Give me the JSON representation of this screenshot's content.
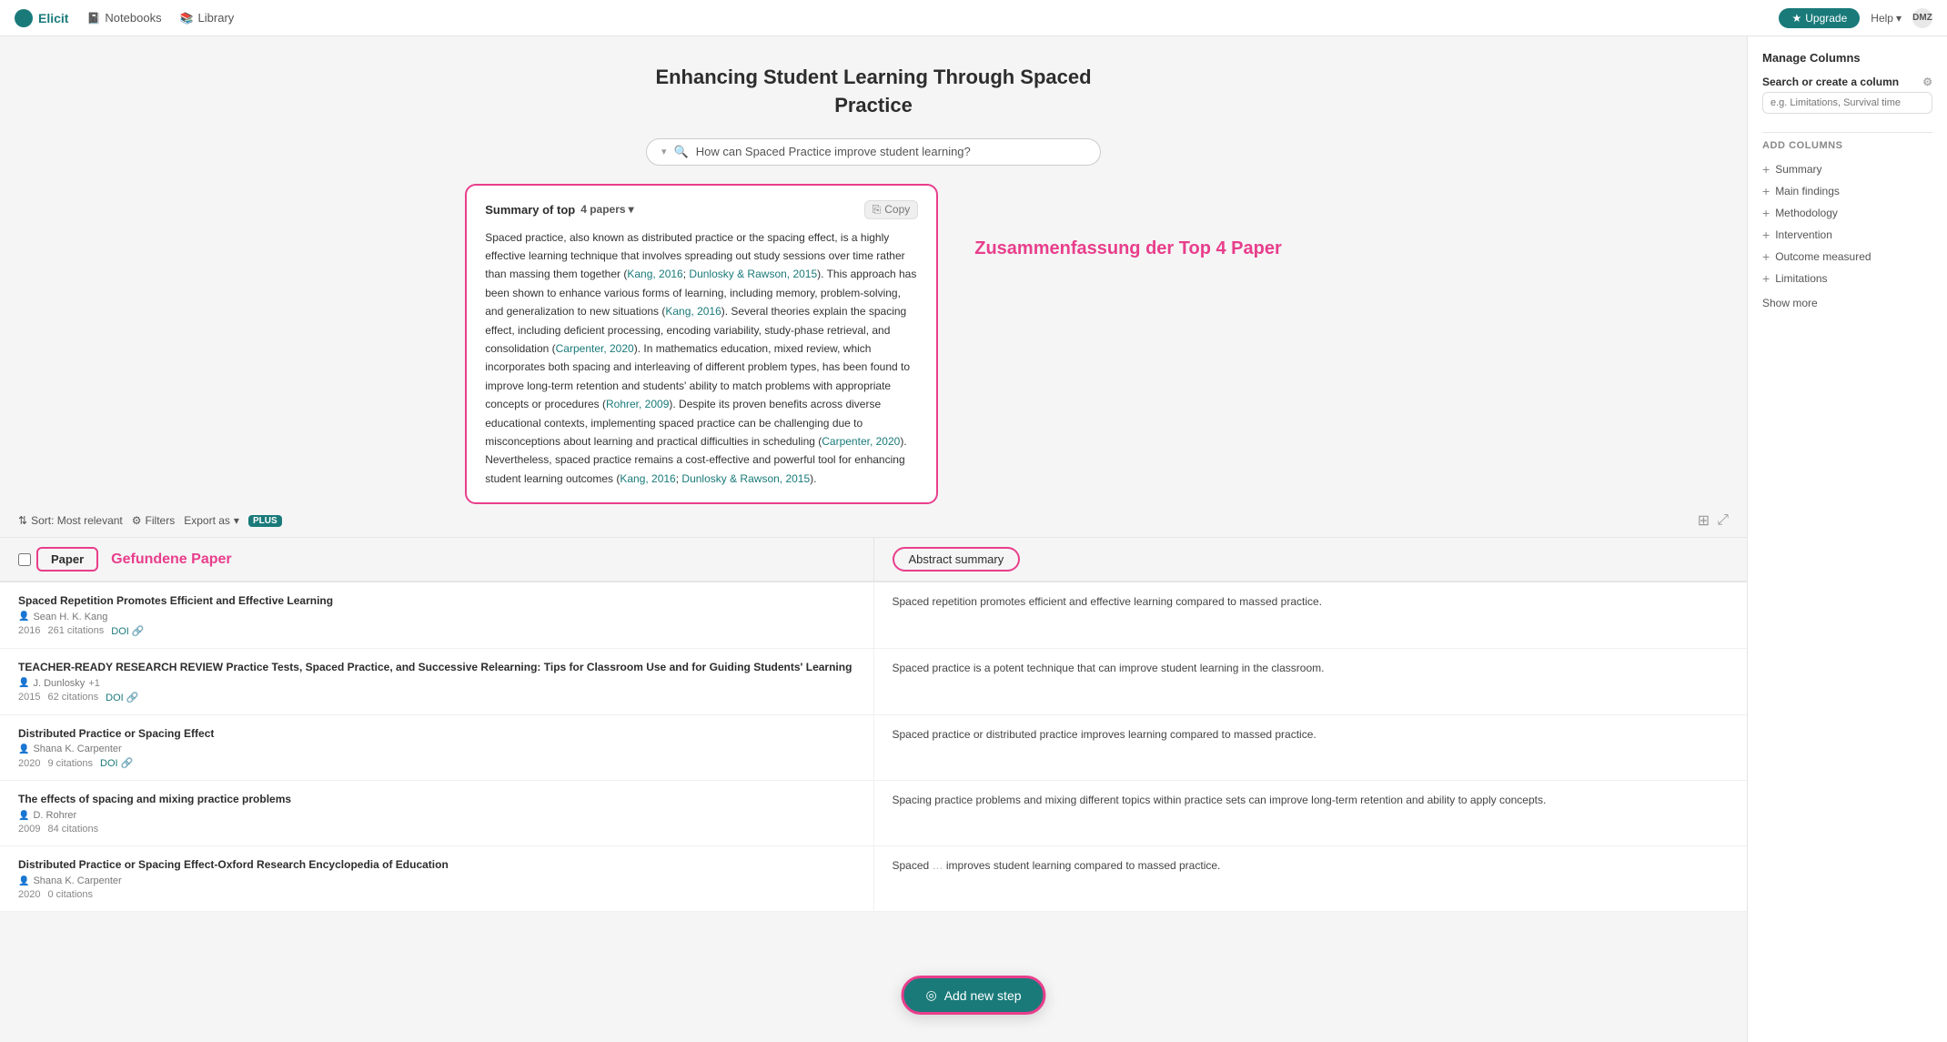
{
  "nav": {
    "logo_text": "Elicit",
    "notebooks_label": "Notebooks",
    "library_label": "Library",
    "upgrade_label": "Upgrade",
    "help_label": "Help",
    "user_label": "DMZ"
  },
  "page": {
    "title_line1": "Enhancing Student Learning Through Spaced",
    "title_line2": "Practice"
  },
  "search": {
    "query": "How can Spaced Practice improve student learning?"
  },
  "summary": {
    "label": "Summary of top",
    "papers_count": "4 papers",
    "copy_label": "Copy",
    "body": "Spaced practice, also known as distributed practice or the spacing effect, is a highly effective learning technique that involves spreading out study sessions over time rather than massing them together (Kang, 2016; Dunlosky & Rawson, 2015). This approach has been shown to enhance various forms of learning, including memory, problem-solving, and generalization to new situations (Kang, 2016). Several theories explain the spacing effect, including deficient processing, encoding variability, study-phase retrieval, and consolidation (Carpenter, 2020). In mathematics education, mixed review, which incorporates both spacing and interleaving of different problem types, has been found to improve long-term retention and students' ability to match problems with appropriate concepts or procedures (Rohrer, 2009). Despite its proven benefits across diverse educational contexts, implementing spaced practice can be challenging due to misconceptions about learning and practical difficulties in scheduling (Carpenter, 2020). Nevertheless, spaced practice remains a cost-effective and powerful tool for enhancing student learning outcomes (Kang, 2016; Dunlosky & Rawson, 2015).",
    "annotation": "Zusammenfassung der Top 4 Paper"
  },
  "toolbar": {
    "sort_label": "Sort: Most relevant",
    "filters_label": "Filters",
    "export_label": "Export as",
    "plus_label": "PLUS"
  },
  "table": {
    "col_paper": "Paper",
    "col_abstract": "Abstract summary",
    "col_manage": "Manage Columns",
    "annotation_paper": "Gefundene Paper"
  },
  "papers": [
    {
      "title": "Spaced Repetition Promotes Efficient and Effective Learning",
      "author": "Sean H. K. Kang",
      "year": "2016",
      "citations": "261 citations",
      "has_doi": true,
      "abstract": "Spaced repetition promotes efficient and effective learning compared to massed practice."
    },
    {
      "title": "TEACHER-READY RESEARCH REVIEW Practice Tests, Spaced Practice, and Successive Relearning: Tips for Classroom Use and for Guiding Students' Learning",
      "author": "J. Dunlosky",
      "author_extra": "+1",
      "year": "2015",
      "citations": "62 citations",
      "has_doi": true,
      "abstract": "Spaced practice is a potent technique that can improve student learning in the classroom."
    },
    {
      "title": "Distributed Practice or Spacing Effect",
      "author": "Shana K. Carpenter",
      "year": "2020",
      "citations": "9 citations",
      "has_doi": true,
      "abstract": "Spaced practice or distributed practice improves learning compared to massed practice."
    },
    {
      "title": "The effects of spacing and mixing practice problems",
      "author": "D. Rohrer",
      "year": "2009",
      "citations": "84 citations",
      "has_doi": false,
      "abstract": "Spacing practice problems and mixing different topics within practice sets can improve long-term retention and ability to apply concepts."
    },
    {
      "title": "Distributed Practice or Spacing Effect-Oxford Research Encyclopedia of Education",
      "author": "Shana K. Carpenter",
      "year": "2020",
      "citations": "0 citations",
      "has_doi": false,
      "abstract": "Spaced practice improves student learning compared to massed practice."
    }
  ],
  "right_panel": {
    "title": "Manage Columns",
    "search_label": "Search or create a column",
    "search_placeholder": "e.g. Limitations, Survival time",
    "add_cols_label": "ADD COLUMNS",
    "columns": [
      {
        "label": "Summary"
      },
      {
        "label": "Main findings"
      },
      {
        "label": "Methodology"
      },
      {
        "label": "Intervention"
      },
      {
        "label": "Outcome measured"
      },
      {
        "label": "Limitations"
      }
    ],
    "show_more": "Show more"
  },
  "add_step": {
    "label": "Add new step"
  }
}
